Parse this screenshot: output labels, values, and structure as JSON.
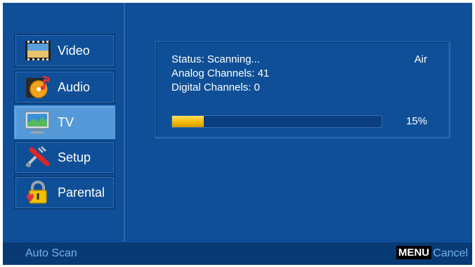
{
  "menu": {
    "items": [
      {
        "label": "Video",
        "icon": "film-icon"
      },
      {
        "label": "Audio",
        "icon": "music-disc-icon"
      },
      {
        "label": "TV",
        "icon": "tv-icon",
        "selected": true
      },
      {
        "label": "Setup",
        "icon": "tools-icon"
      },
      {
        "label": "Parental",
        "icon": "padlock-icon"
      }
    ]
  },
  "scan": {
    "status": "Status: Scanning...",
    "mode": "Air",
    "analog": "Analog Channels: 41",
    "digital": "Digital Channels: 0",
    "progress_percent": 15,
    "progress_label": "15%"
  },
  "footer": {
    "title": "Auto Scan",
    "menu_key": "MENU",
    "cancel": "Cancel"
  },
  "colors": {
    "background": "#0f4f98",
    "selected": "#5599d8",
    "progress": "#f2b800",
    "footer_text": "#6fb3e8"
  }
}
